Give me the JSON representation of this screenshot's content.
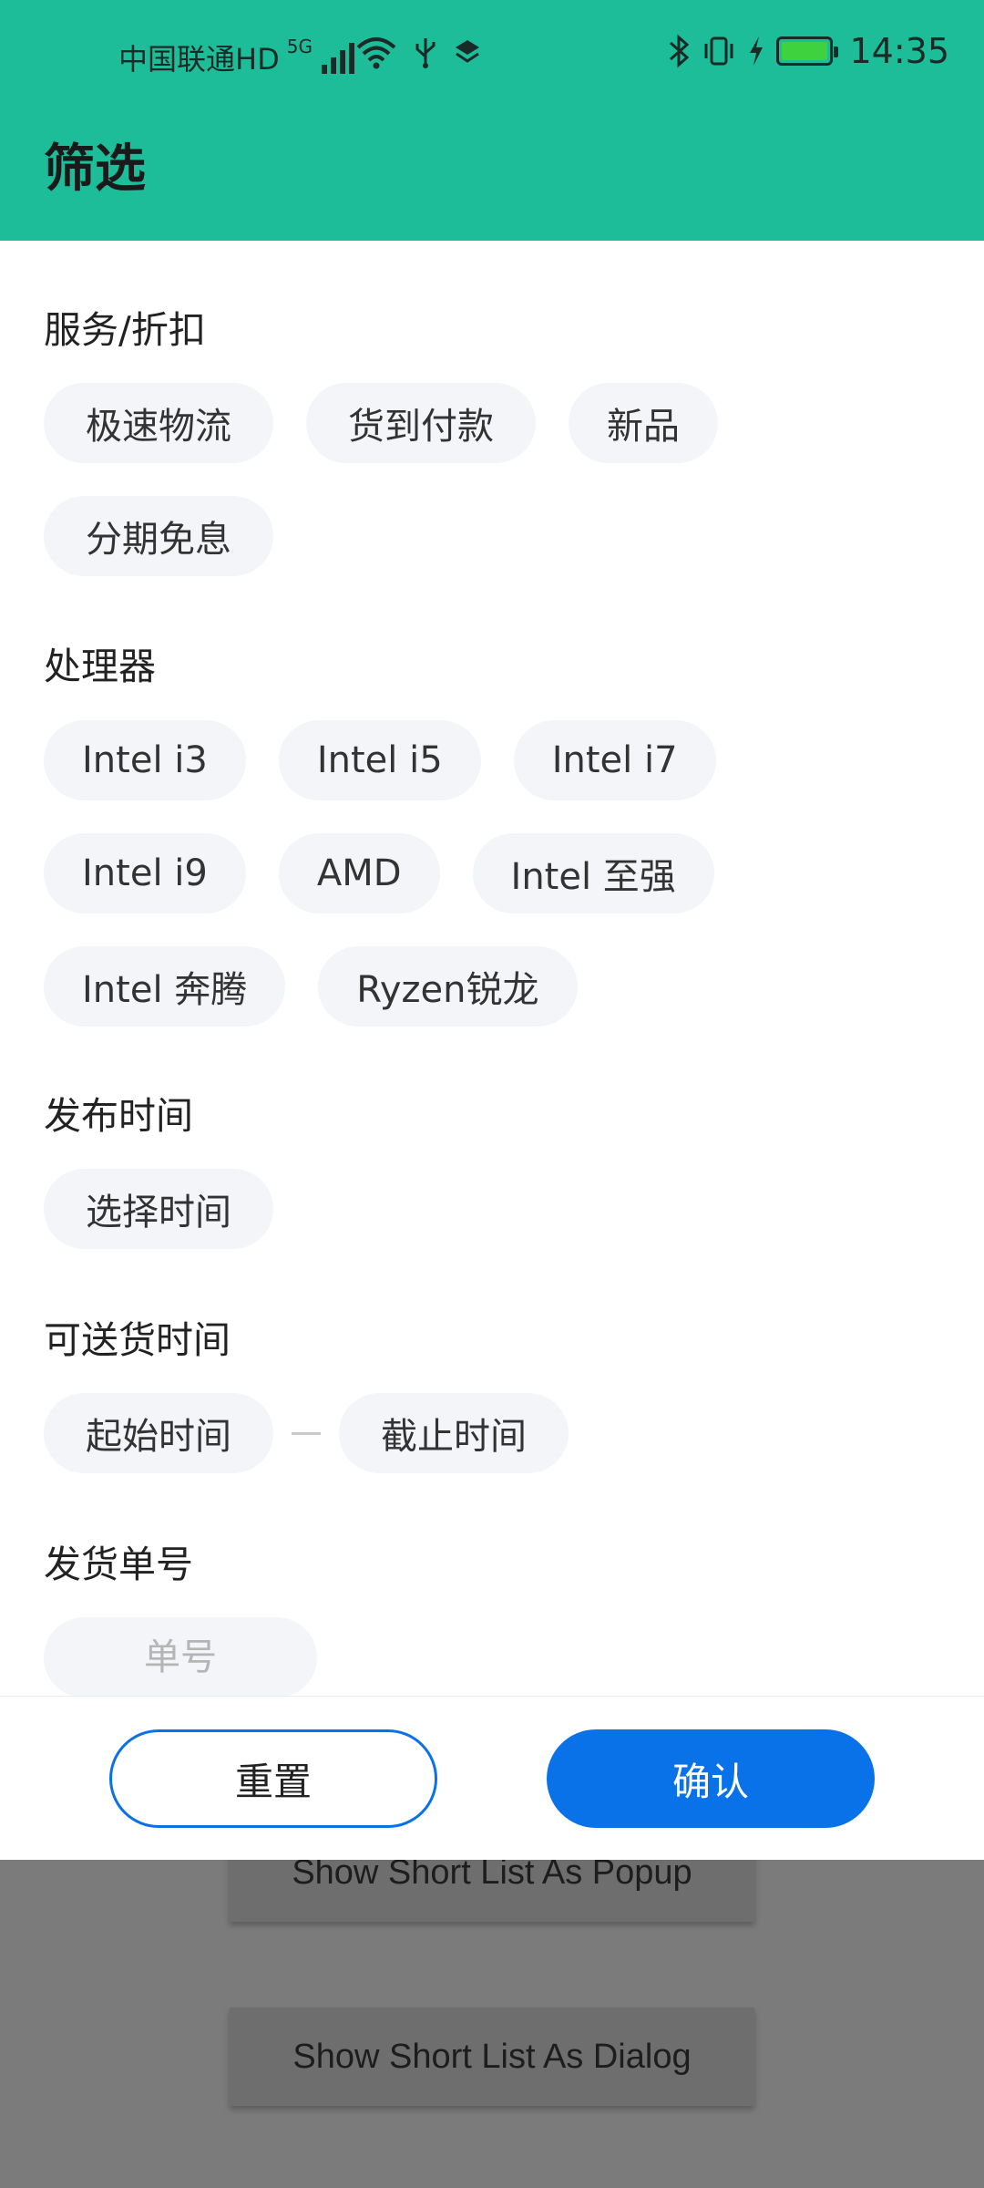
{
  "status_bar": {
    "carrier": "中国联通HD",
    "network": "5G",
    "time": "14:35"
  },
  "header": {
    "title": "筛选"
  },
  "sections": [
    {
      "title": "服务/折扣",
      "chips": [
        "极速物流",
        "货到付款",
        "新品",
        "分期免息"
      ]
    },
    {
      "title": "处理器",
      "chips": [
        "Intel i3",
        "Intel i5",
        "Intel i7",
        "Intel i9",
        "AMD",
        "Intel 至强",
        "Intel 奔腾",
        "Ryzen锐龙"
      ]
    },
    {
      "title": "发布时间",
      "chips": [
        "选择时间"
      ]
    },
    {
      "title": "可送货时间",
      "start": "起始时间",
      "end": "截止时间"
    },
    {
      "title": "发货单号",
      "placeholder": "单号"
    }
  ],
  "footer": {
    "reset_label": "重置",
    "confirm_label": "确认"
  },
  "background_app": {
    "buttons": [
      "Show Short List As Popup",
      "Show Short List As Dialog"
    ]
  },
  "colors": {
    "header": "#1ebd99",
    "accent": "#0a72e8",
    "chip_bg": "#f4f5f8",
    "battery_fill": "#3fd23f"
  }
}
